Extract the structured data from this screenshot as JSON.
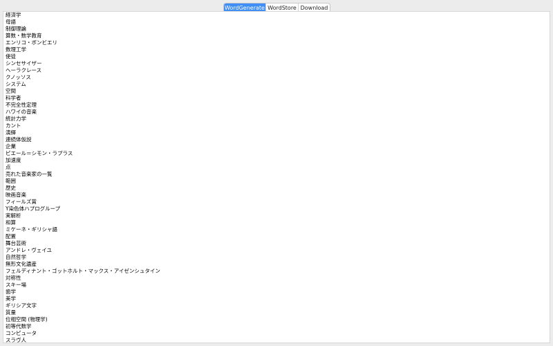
{
  "tabs": [
    {
      "label": "WordGenerate",
      "selected": true
    },
    {
      "label": "WordStore",
      "selected": false
    },
    {
      "label": "Download",
      "selected": false
    }
  ],
  "colors": {
    "window_bg": "#ececec",
    "selected_tab": "#3f8ef5",
    "list_bg": "#ffffff"
  },
  "words": [
    "経済学",
    "母語",
    "制御理論",
    "算数・数学教育",
    "エンリコ・ボンビエリ",
    "数理工学",
    "使徒",
    "シンセサイザー",
    "ヘーラクレース",
    "クノッソス",
    "システム",
    "空間",
    "科学者",
    "不完全性定理",
    "ハワイの音楽",
    "統計力学",
    "カント",
    "演繹",
    "連続体仮説",
    "企業",
    "ピエール＝シモン・ラプラス",
    "加速度",
    "点",
    "売れた音楽家の一覧",
    "範囲",
    "歴史",
    "映画音楽",
    "フィールズ賞",
    "Y染色体ハプログループ",
    "実解析",
    "和算",
    "ミケーネ・ギリシャ語",
    "配置",
    "舞台芸術",
    "アンドレ・ヴェイユ",
    "自然哲学",
    "無形文化遺産",
    "フェルディナント・ゴットホルト・マックス・アイゼンシュタイン",
    "対称性",
    "スキー場",
    "歯学",
    "美学",
    "ギリシア文字",
    "質量",
    "位相空間 (物理学)",
    "初等代数学",
    "コンピュータ",
    "スラヴ人"
  ]
}
